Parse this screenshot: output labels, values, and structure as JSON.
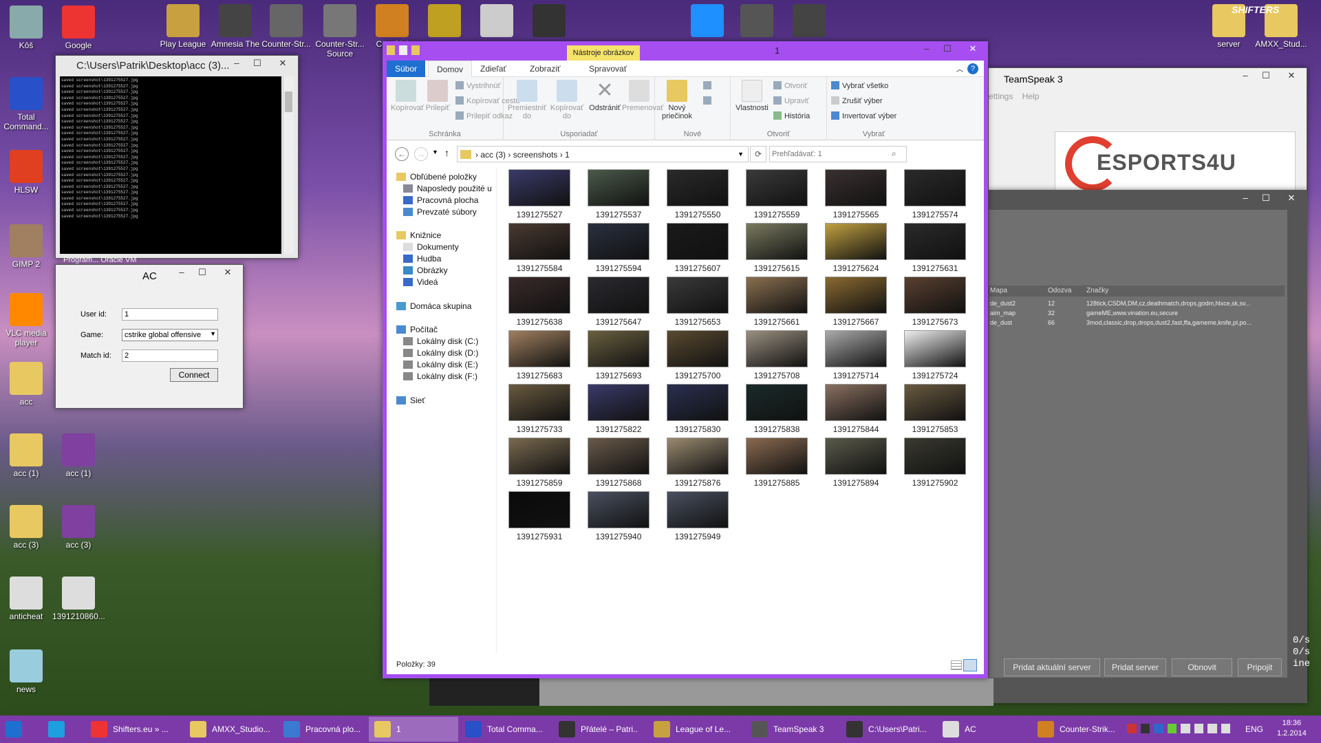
{
  "desktop_icons": [
    {
      "label": "Kôš",
      "color": "#8aa"
    },
    {
      "label": "Google",
      "color": "#e33"
    },
    {
      "label": "Total Command...",
      "color": "#2850c8"
    },
    {
      "label": "HLSW",
      "color": "#e04020"
    },
    {
      "label": "GIMP 2",
      "color": "#a08060"
    },
    {
      "label": "VLC media player",
      "color": "#f80"
    },
    {
      "label": "acc",
      "color": "#e8c860"
    },
    {
      "label": "acc (1)",
      "color": "#e8c860"
    },
    {
      "label": "acc (1)",
      "color": "#8040a0"
    },
    {
      "label": "acc (3)",
      "color": "#e8c860"
    },
    {
      "label": "acc (3)",
      "color": "#8040a0"
    },
    {
      "label": "anticheat",
      "color": "#ddd"
    },
    {
      "label": "1391210860...",
      "color": "#ddd"
    },
    {
      "label": "news",
      "color": "#9cd"
    }
  ],
  "top_icons": [
    {
      "label": "Play League",
      "color": "#c8a040"
    },
    {
      "label": "Amnesia The",
      "color": "#444"
    },
    {
      "label": "Counter-Str...",
      "color": "#666"
    },
    {
      "label": "Counter-Str... Source",
      "color": "#777"
    },
    {
      "label": "Cou Glol",
      "color": "#d08020"
    },
    {
      "label": "",
      "color": "#c0a020"
    },
    {
      "label": "",
      "color": "#ccc"
    },
    {
      "label": "",
      "color": "#333"
    },
    {
      "label": "",
      "color": "#1e90ff"
    },
    {
      "label": "",
      "color": "#555"
    },
    {
      "label": "",
      "color": "#444"
    },
    {
      "label": "server",
      "color": "#e8c860"
    },
    {
      "label": "AMXX_Stud...",
      "color": "#e8c860"
    }
  ],
  "watermark": "SHIFTERS",
  "cmd": {
    "title": "C:\\Users\\Patrik\\Desktop\\acc (3)...",
    "line": "saved screenshot\\1391275527.jpg",
    "lines": 24
  },
  "ac": {
    "title": "AC",
    "userid_label": "User id:",
    "userid": "1",
    "game_label": "Game:",
    "game": "cstrike global offensive",
    "match_label": "Match id:",
    "match": "2",
    "connect": "Connect"
  },
  "behind_text": "Program... Oracle VM",
  "explorer": {
    "title": "1",
    "context_tab": "Nástroje obrázkov",
    "tabs": [
      "Súbor",
      "Domov",
      "Zdieľať",
      "Zobraziť",
      "Spravovať"
    ],
    "groups": {
      "clipboard": "Schránka",
      "organize": "Usporiadať",
      "new": "Nové",
      "open": "Otvoriť",
      "select": "Vybrať"
    },
    "btn": {
      "copy": "Kopírovať",
      "paste": "Prilepiť",
      "cut": "Vystrihnúť",
      "copypath": "Kopírovať cestu",
      "pastelink": "Prilepiť odkaz",
      "move": "Premiestniť do",
      "copyto": "Kopírovať do",
      "delete": "Odstrániť",
      "rename": "Premenovať",
      "newfolder": "Nový priečinok",
      "props": "Vlastnosti",
      "open": "Otvoriť",
      "edit": "Upraviť",
      "history": "História",
      "selall": "Vybrať všetko",
      "selnone": "Zrušiť výber",
      "invert": "Invertovať výber"
    },
    "path": [
      "acc (3)",
      "screenshots",
      "1"
    ],
    "search_placeholder": "Prehľadávať: 1",
    "nav": [
      "Obľúbené položky",
      "Naposledy použité u",
      "Pracovná plocha",
      "Prevzaté súbory",
      "Knižnice",
      "Dokumenty",
      "Hudba",
      "Obrázky",
      "Videá",
      "Domáca skupina",
      "Počítač",
      "Lokálny disk (C:)",
      "Lokálny disk (D:)",
      "Lokálny disk (E:)",
      "Lokálny disk (F:)",
      "Sieť"
    ],
    "files": [
      "1391275527",
      "1391275537",
      "1391275550",
      "1391275559",
      "1391275565",
      "1391275574",
      "1391275584",
      "1391275594",
      "1391275607",
      "1391275615",
      "1391275624",
      "1391275631",
      "1391275638",
      "1391275647",
      "1391275653",
      "1391275661",
      "1391275667",
      "1391275673",
      "1391275683",
      "1391275693",
      "1391275700",
      "1391275708",
      "1391275714",
      "1391275724",
      "1391275733",
      "1391275822",
      "1391275830",
      "1391275838",
      "1391275844",
      "1391275853",
      "1391275859",
      "1391275868",
      "1391275876",
      "1391275885",
      "1391275894",
      "1391275902",
      "1391275931",
      "1391275940",
      "1391275949"
    ],
    "thumb_colors": [
      "#3a3a6a",
      "#4a5a4a",
      "#2a2a2a",
      "#3a3a3a",
      "#3a3030",
      "#2a2a2a",
      "#4a3a30",
      "#2a3040",
      "#1a1a1a",
      "#7a7a60",
      "#c0a040",
      "#2a2a2a",
      "#3a2a2a",
      "#2a2a30",
      "#3a3a3a",
      "#8a7050",
      "#8a6a30",
      "#5a4030",
      "#a08060",
      "#6a6040",
      "#5a4a30",
      "#9a9080",
      "#aaaaaa",
      "#eeeeee",
      "#6a5a40",
      "#3a3a6a",
      "#2a3050",
      "#1a2a2a",
      "#8a7060",
      "#6a5a40",
      "#7a6a50",
      "#6a5a4a",
      "#9a8a70",
      "#8a6a50",
      "#5a5a4a",
      "#3a3a30",
      "#0a0a0a",
      "#4a5060",
      "#4a5060"
    ],
    "status": "Položky: 39"
  },
  "teamspeak": {
    "title": "TeamSpeak 3",
    "menu": [
      "ettings",
      "Help"
    ],
    "banner": "ESPORTS4U"
  },
  "server": {
    "cols": [
      "Mapa",
      "Odozva",
      "Značky"
    ],
    "rows": [
      [
        "de_dust2",
        "12",
        "128tick,CSDM,DM,cz,deathmatch,drops,godm,hlxce,sk,sv..."
      ],
      [
        "aim_map",
        "32",
        "gameME,www.vination.eu,secure"
      ],
      [
        "de_dust",
        "66",
        "3mod,classic,drop,drops,dust2,fast,ffa,gameme,knife,pl,po..."
      ]
    ],
    "btns": [
      "Pridat aktuální server",
      "Pridat server",
      "Obnovit",
      "Pripojit"
    ],
    "side": [
      "0/s",
      "0/s",
      "ine"
    ]
  },
  "taskbar": {
    "items": [
      {
        "label": "",
        "color": "#1e6fd0"
      },
      {
        "label": "",
        "color": "#1e9fe0"
      },
      {
        "label": "Shifters.eu » ...",
        "color": "#e33"
      },
      {
        "label": "AMXX_Studio...",
        "color": "#e8c860"
      },
      {
        "label": "Pracovná plo...",
        "color": "#3a7ad0"
      },
      {
        "label": "1",
        "color": "#e8c860"
      },
      {
        "label": "Total Comma...",
        "color": "#2850c8"
      },
      {
        "label": "Přátelé – Patri...",
        "color": "#333"
      },
      {
        "label": "League of Le...",
        "color": "#c8a040"
      },
      {
        "label": "TeamSpeak 3",
        "color": "#555"
      },
      {
        "label": "C:\\Users\\Patri...",
        "color": "#333"
      },
      {
        "label": "AC",
        "color": "#ddd"
      },
      {
        "label": "Counter-Strik...",
        "color": "#d08020"
      }
    ],
    "lang": "ENG",
    "time": "18:36",
    "date": "1.2.2014"
  }
}
